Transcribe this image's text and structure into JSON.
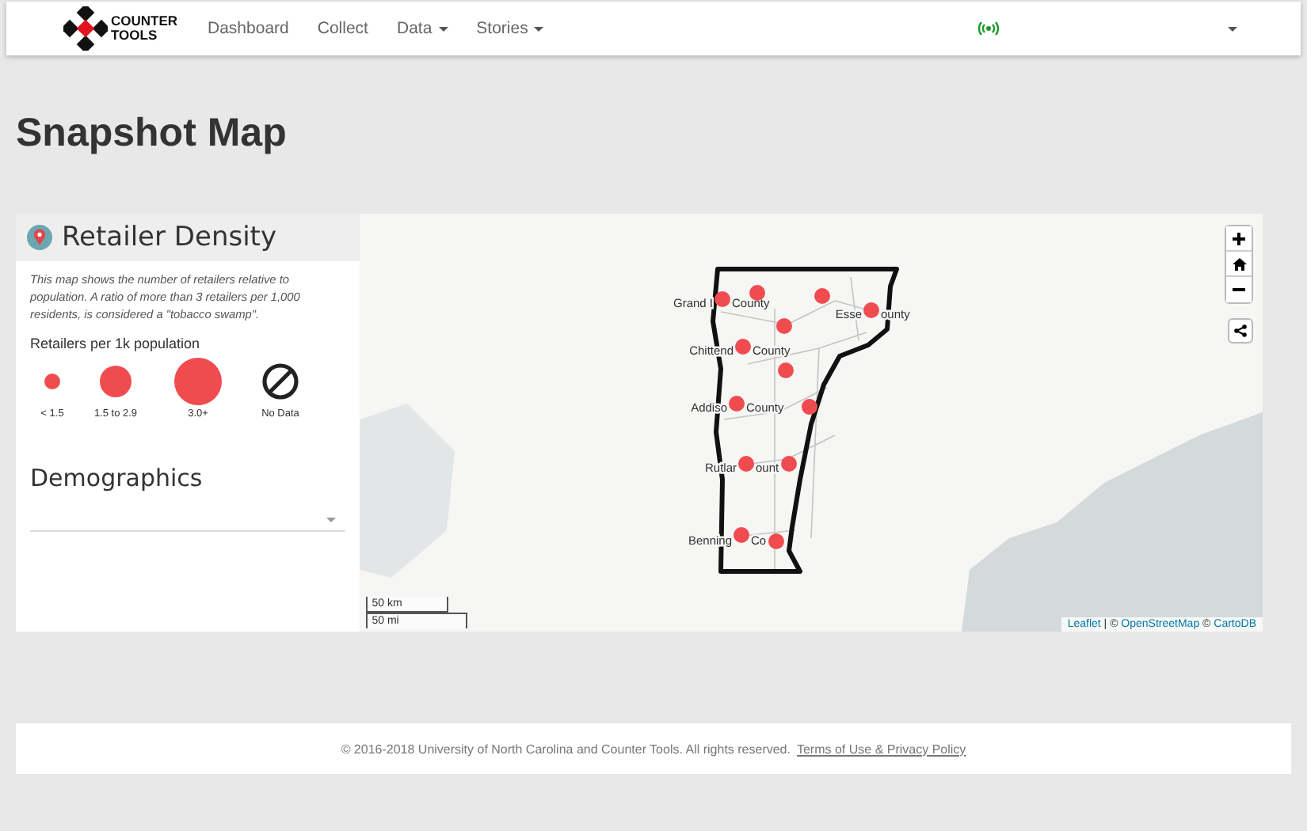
{
  "navbar": {
    "logo": "COUNTER TOOLS",
    "links": [
      {
        "label": "Dashboard",
        "dropdown": false
      },
      {
        "label": "Collect",
        "dropdown": false
      },
      {
        "label": "Data",
        "dropdown": true
      },
      {
        "label": "Stories",
        "dropdown": true
      }
    ]
  },
  "page_title": "Snapshot Map",
  "sidebar": {
    "title": "Retailer Density",
    "description": "This map shows the number of retailers relative to population. A ratio of more than 3 retailers per 1,000 residents, is considered a \"tobacco swamp\".",
    "legend_title": "Retailers per 1k population",
    "legend": [
      {
        "kind": "small",
        "label": "< 1.5"
      },
      {
        "kind": "medium",
        "label": "1.5 to 2.9"
      },
      {
        "kind": "large",
        "label": "3.0+"
      },
      {
        "kind": "none",
        "label": "No Data"
      }
    ],
    "section_title": "Demographics"
  },
  "map": {
    "county_labels": [
      {
        "left": "Grand I",
        "right": "County"
      },
      {
        "left": "Esse",
        "right": "ounty"
      },
      {
        "left": "Chittend",
        "right": "County"
      },
      {
        "left": "Addiso",
        "right": "County"
      },
      {
        "left": "Rutlar",
        "right": "ount"
      },
      {
        "left": "Benning",
        "right": "Co"
      }
    ],
    "scale": [
      "50 km",
      "50 mi"
    ],
    "attribution": [
      {
        "text": "Leaflet",
        "link": true
      },
      {
        "text": " | © ",
        "link": false
      },
      {
        "text": "OpenStreetMap",
        "link": true
      },
      {
        "text": " © ",
        "link": false
      },
      {
        "text": "CartoDB",
        "link": true
      }
    ]
  },
  "footer": {
    "text": "© 2016-2018 University of North Carolina and Counter Tools. All rights reserved.",
    "link": "Terms of Use & Privacy Policy"
  }
}
